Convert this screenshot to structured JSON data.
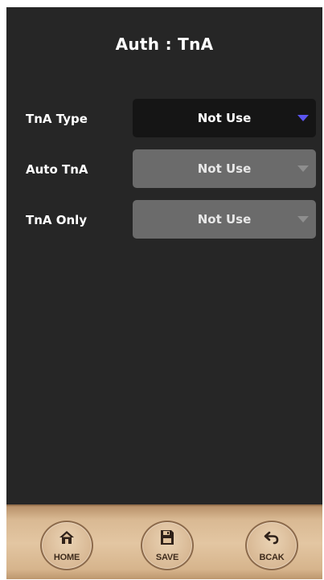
{
  "header": {
    "title": "Auth : TnA"
  },
  "settings": [
    {
      "label": "TnA Type",
      "value": "Not Use",
      "state": "enabled"
    },
    {
      "label": "Auto TnA",
      "value": "Not Use",
      "state": "disabled"
    },
    {
      "label": "TnA Only",
      "value": "Not Use",
      "state": "disabled"
    }
  ],
  "footer": {
    "home_label": "HOME",
    "save_label": "SAVE",
    "back_label": "BCAK"
  },
  "colors": {
    "background": "#262626",
    "active_dropdown": "#151515",
    "disabled_dropdown": "#6b6b6b",
    "active_arrow": "#5b55f0",
    "footer": "#e3c6a2"
  },
  "icons": {
    "home": "home-icon",
    "save": "save-icon",
    "back": "back-arrow-icon",
    "dropdown": "chevron-down-icon"
  }
}
